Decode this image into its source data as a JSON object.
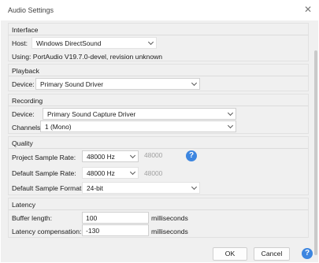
{
  "window": {
    "title": "Audio Settings",
    "close_glyph": "✕"
  },
  "interface": {
    "group_title": "Interface",
    "host_label": "Host:",
    "host_value": "Windows DirectSound",
    "using_text": "Using: PortAudio V19.7.0-devel, revision unknown"
  },
  "playback": {
    "group_title": "Playback",
    "device_label": "Device:",
    "device_value": "Primary Sound Driver"
  },
  "recording": {
    "group_title": "Recording",
    "device_label": "Device:",
    "device_value": "Primary Sound Capture Driver",
    "channels_label": "Channels:",
    "channels_value": "1 (Mono)"
  },
  "quality": {
    "group_title": "Quality",
    "project_rate_label": "Project Sample Rate:",
    "project_rate_value": "48000 Hz",
    "project_rate_other": "48000",
    "default_rate_label": "Default Sample Rate:",
    "default_rate_value": "48000 Hz",
    "default_rate_other": "48000",
    "default_format_label": "Default Sample Format:",
    "default_format_value": "24-bit",
    "help_glyph": "?"
  },
  "latency": {
    "group_title": "Latency",
    "buffer_label": "Buffer length:",
    "buffer_value": "100",
    "buffer_unit": "milliseconds",
    "compensation_label": "Latency compensation:",
    "compensation_value": "-130",
    "compensation_unit": "milliseconds"
  },
  "buttons": {
    "ok": "OK",
    "cancel": "Cancel",
    "help_glyph": "?"
  },
  "colors": {
    "accent": "#3d86e0",
    "client_bg": "#f0f0f0"
  }
}
